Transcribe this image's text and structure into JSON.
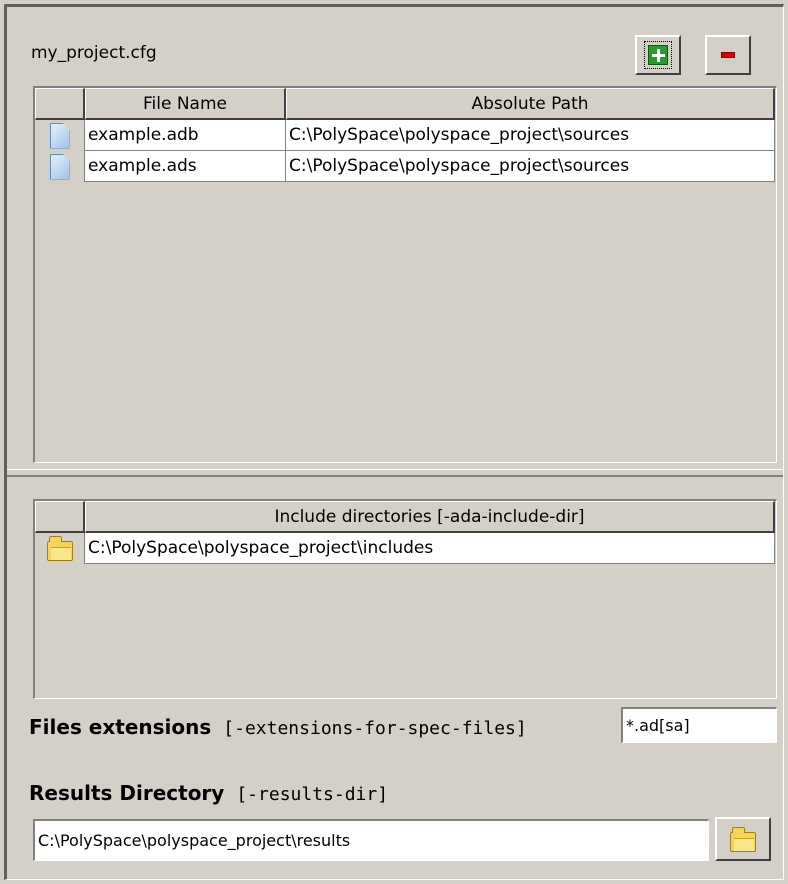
{
  "project": {
    "title": "my_project.cfg"
  },
  "toolbar": {
    "add_icon": "plus-icon",
    "remove_icon": "minus-icon",
    "colors": {
      "add": "#2a9a2a",
      "remove": "#e00000"
    }
  },
  "sources_table": {
    "headers": [
      "File Name",
      "Absolute Path"
    ],
    "rows": [
      {
        "icon": "file-icon",
        "file_name": "example.adb",
        "path": "C:\\PolySpace\\polyspace_project\\sources"
      },
      {
        "icon": "file-icon",
        "file_name": "example.ads",
        "path": "C:\\PolySpace\\polyspace_project\\sources"
      }
    ]
  },
  "include_table": {
    "header": "Include directories [-ada-include-dir]",
    "rows": [
      {
        "icon": "folder-icon",
        "path": "C:\\PolySpace\\polyspace_project\\includes"
      }
    ]
  },
  "extensions": {
    "label": "Files extensions",
    "option": "[-extensions-for-spec-files]",
    "value": "*.ad[sa]"
  },
  "results": {
    "label": "Results Directory",
    "option": "[-results-dir]",
    "value": "C:\\PolySpace\\polyspace_project\\results"
  }
}
